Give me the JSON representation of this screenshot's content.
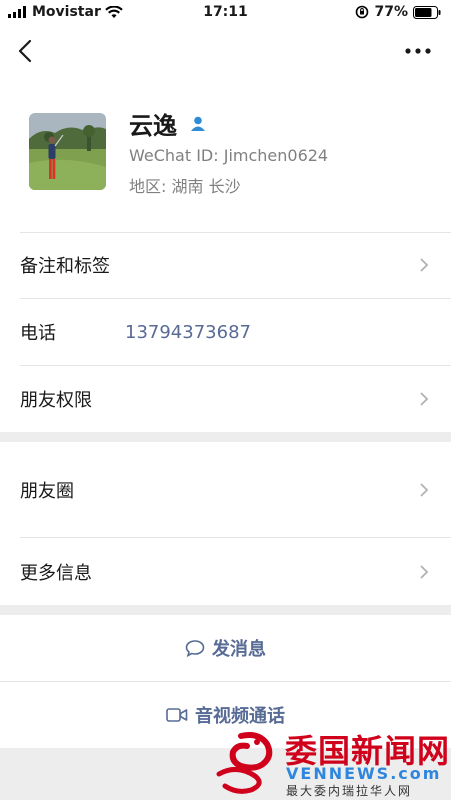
{
  "status": {
    "carrier": "Movistar",
    "time": "17:11",
    "battery": "77%"
  },
  "profile": {
    "name": "云逸",
    "wechat_id": "WeChat ID: Jimchen0624",
    "region": "地区: 湖南 长沙"
  },
  "rows": {
    "remarks_tags": "备注和标签",
    "phone_label": "电话",
    "phone_value": "13794373687",
    "friend_permissions": "朋友权限",
    "moments": "朋友圈",
    "more_info": "更多信息"
  },
  "actions": {
    "send_message": "发消息",
    "video_call": "音视频通话"
  },
  "watermark": {
    "cn": "委国新闻网",
    "en": "VENNEWS.com",
    "sub": "最大委内瑞拉华人网"
  },
  "colors": {
    "link": "#576b95",
    "background": "#ededed",
    "watermark_red": "#d0021b",
    "watermark_blue": "#2e86de"
  },
  "icons": [
    "wifi-icon",
    "back-icon",
    "more-icon",
    "contact-badge-icon",
    "chevron-right-icon",
    "message-bubble-icon",
    "video-camera-icon"
  ]
}
